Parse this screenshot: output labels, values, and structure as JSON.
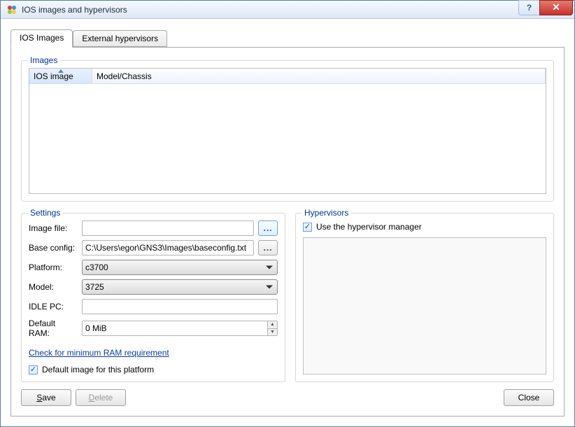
{
  "window": {
    "title": "IOS images and hypervisors"
  },
  "tabs": {
    "ios": "IOS Images",
    "ext": "External hypervisors"
  },
  "images_group": {
    "legend": "Images",
    "columns": {
      "c0": "IOS image",
      "c1": "Model/Chassis"
    }
  },
  "settings": {
    "legend": "Settings",
    "labels": {
      "image_file": "Image file:",
      "base_config": "Base config:",
      "platform": "Platform:",
      "model": "Model:",
      "idle_pc": "IDLE PC:",
      "default_ram": "Default RAM:"
    },
    "values": {
      "image_file": "",
      "base_config": "C:\\Users\\egor\\GNS3\\Images\\baseconfig.txt",
      "platform": "c3700",
      "model": "3725",
      "idle_pc": "",
      "default_ram": "0 MiB"
    },
    "browse_label": "...",
    "link": "Check for minimum RAM requirement",
    "default_image_chk": "Default image for this platform"
  },
  "hypervisors": {
    "legend": "Hypervisors",
    "use_manager_chk": "Use the hypervisor manager"
  },
  "buttons": {
    "save_pre": "",
    "save_u": "S",
    "save_post": "ave",
    "delete_pre": "",
    "delete_u": "D",
    "delete_post": "elete",
    "close": "Close"
  },
  "glyphs": {
    "check": "✓",
    "help": "?",
    "close_x": "✕",
    "up": "▲",
    "down": "▼"
  }
}
